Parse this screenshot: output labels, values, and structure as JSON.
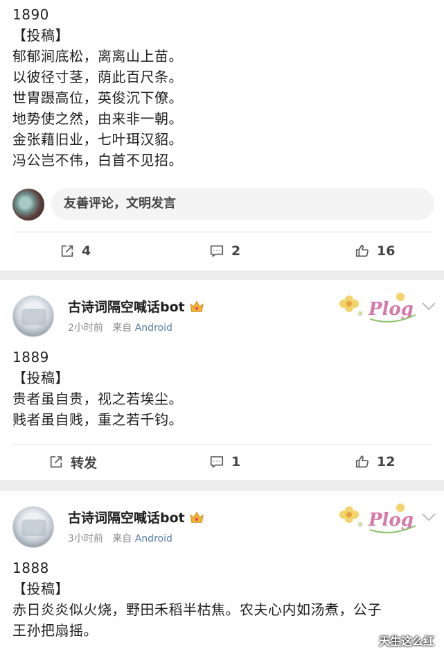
{
  "post1": {
    "lines": [
      "1890",
      "【投稿】",
      "郁郁涧底松，离离山上苗。",
      "以彼径寸茎，荫此百尺条。",
      "世胄蹑高位，英俊沉下僚。",
      "地势使之然，由来非一朝。",
      "金张藉旧业，七叶珥汉貂。",
      "冯公岂不伟，白首不见招。"
    ],
    "comment_placeholder": "友善评论，文明发言",
    "repost": "4",
    "comments": "2",
    "likes": "16"
  },
  "post2": {
    "author": "古诗词隔空喊话bot",
    "time": "2小时前",
    "from_label": "来自",
    "source": "Android",
    "lines": [
      "1889",
      "【投稿】",
      "贵者虽自贵，视之若埃尘。",
      "贱者虽自贱，重之若千钧。"
    ],
    "repost": "转发",
    "comments": "1",
    "likes": "12"
  },
  "post3": {
    "author": "古诗词隔空喊话bot",
    "time": "3小时前",
    "from_label": "来自",
    "source": "Android",
    "lines": [
      "1888",
      "【投稿】",
      "赤日炎炎似火烧，野田禾稻半枯焦。农夫心内如汤煮，公子",
      "王孙把扇摇。"
    ]
  },
  "badge_text": "Plog",
  "watermark": "天生这么红",
  "colors": {
    "link": "#5a7ea8",
    "badge_yellow": "#f3d36b",
    "badge_pink": "#d57aa8"
  }
}
